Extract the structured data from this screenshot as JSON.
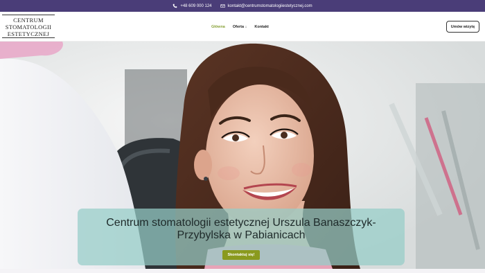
{
  "topbar": {
    "phone": "+48 609 000 124",
    "email": "kontakt@centrumstomatologiiestetycznej.com",
    "phone_icon": "phone-icon",
    "email_icon": "envelope-icon",
    "background": "#4a3d78"
  },
  "logo": {
    "line1": "CENTRUM",
    "line2": "STOMATOLOGII",
    "line3": "ESTETYCZNEJ"
  },
  "nav": {
    "items": [
      {
        "label": "Główna",
        "active": true
      },
      {
        "label": "Oferta ↓",
        "active": false
      },
      {
        "label": "Kontakt",
        "active": false
      }
    ],
    "active_color": "#8aa33a"
  },
  "cta": {
    "label": "Umów wizytę"
  },
  "hero": {
    "title": "Centrum stomatologii estetycznej Urszula Banaszczyk-Przybylska w Pabianicach",
    "button": "Skontaktuj się!",
    "button_color": "#8a9a1e",
    "panel_color": "#96cdc8"
  }
}
